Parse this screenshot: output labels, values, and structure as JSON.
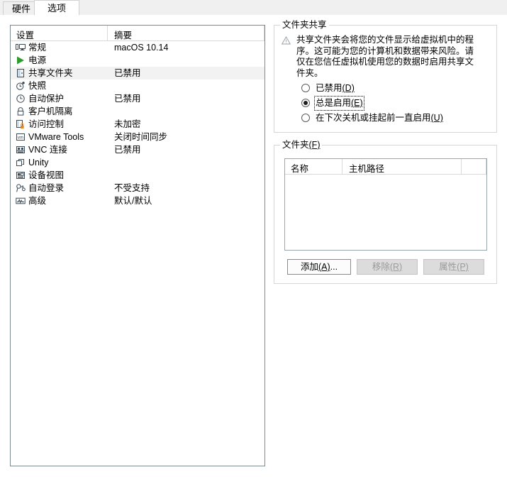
{
  "tabs": [
    {
      "label": "硬件",
      "active": false
    },
    {
      "label": "选项",
      "active": true
    }
  ],
  "settings_list": {
    "columns": {
      "setting": "设置",
      "summary": "摘要"
    },
    "rows": [
      {
        "icon": "monitor-icon",
        "label": "常规",
        "summary": "macOS 10.14",
        "selected": false
      },
      {
        "icon": "power-play-icon",
        "label": "电源",
        "summary": "",
        "selected": false
      },
      {
        "icon": "shared-folder-icon",
        "label": "共享文件夹",
        "summary": "已禁用",
        "selected": true
      },
      {
        "icon": "snapshot-clock-icon",
        "label": "快照",
        "summary": "",
        "selected": false
      },
      {
        "icon": "clock-icon",
        "label": "自动保护",
        "summary": "已禁用",
        "selected": false
      },
      {
        "icon": "lock-icon",
        "label": "客户机隔离",
        "summary": "",
        "selected": false
      },
      {
        "icon": "access-lock-icon",
        "label": "访问控制",
        "summary": "未加密",
        "selected": false
      },
      {
        "icon": "vmware-tools-icon",
        "label": "VMware Tools",
        "summary": "关闭时间同步",
        "selected": false
      },
      {
        "icon": "vnc-icon",
        "label": "VNC 连接",
        "summary": "已禁用",
        "selected": false
      },
      {
        "icon": "unity-icon",
        "label": "Unity",
        "summary": "",
        "selected": false
      },
      {
        "icon": "device-view-icon",
        "label": "设备视图",
        "summary": "",
        "selected": false
      },
      {
        "icon": "auto-login-icon",
        "label": "自动登录",
        "summary": "不受支持",
        "selected": false
      },
      {
        "icon": "advanced-wave-icon",
        "label": "高级",
        "summary": "默认/默认",
        "selected": false
      }
    ]
  },
  "folder_sharing": {
    "title": "文件夹共享",
    "warning": "共享文件夹会将您的文件显示给虚拟机中的程序。这可能为您的计算机和数据带来风险。请仅在您信任虚拟机使用您的数据时启用共享文件夹。",
    "options": [
      {
        "text": "已禁用",
        "mnemonic": "(D)",
        "checked": false,
        "focused": false
      },
      {
        "text": "总是启用",
        "mnemonic": "(E)",
        "checked": true,
        "focused": true
      },
      {
        "text": "在下次关机或挂起前一直启用",
        "mnemonic": "(U)",
        "checked": false,
        "focused": false
      }
    ]
  },
  "folders": {
    "title": "文件夹",
    "title_mnemonic": "(F)",
    "columns": [
      "名称",
      "主机路径"
    ],
    "rows": [],
    "buttons": [
      {
        "text": "添加",
        "mnemonic": "(A)",
        "suffix": "...",
        "enabled": true
      },
      {
        "text": "移除",
        "mnemonic": "(R)",
        "suffix": "",
        "enabled": false
      },
      {
        "text": "属性",
        "mnemonic": "(P)",
        "suffix": "",
        "enabled": false
      }
    ]
  },
  "colors": {
    "selection": "#f2f2f2",
    "panel_border": "#7d8a90",
    "accent_green": "#2e9b2e",
    "accent_orange": "#e8861a"
  }
}
